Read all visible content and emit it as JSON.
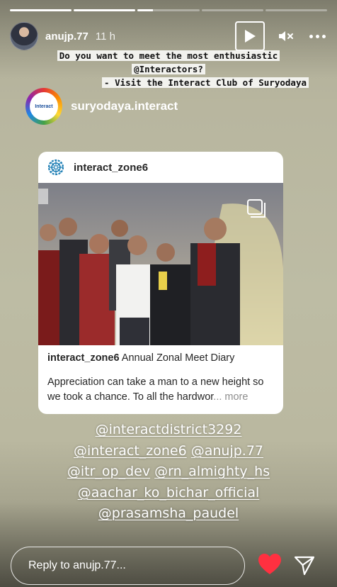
{
  "story": {
    "progress_segments": [
      1,
      1,
      0.25,
      0,
      0
    ],
    "user": {
      "username": "anujp.77",
      "time": "11 h"
    },
    "caption_lines": [
      "Do you want to meet the most enthusiastic",
      "@Interactors?",
      "- Visit the Interact Club of Suryodaya"
    ],
    "mention": {
      "name": "suryodaya.interact",
      "logo_text": "Interact"
    },
    "shared_post": {
      "account": "interact_zone6",
      "title_account": "interact_zone6",
      "title_text": "Annual Zonal Meet Diary",
      "body": "Appreciation can take a man to a new height so we took a chance. To all the hardwor",
      "more": "... more"
    },
    "tag_lines": [
      [
        "@interactdistrict3292"
      ],
      [
        "@interact_zone6",
        "@anujp.77"
      ],
      [
        "@itr_op_dev",
        "@rn_almighty_hs"
      ],
      [
        "@aachar_ko_bichar_official"
      ],
      [
        "@prasamsha_paudel"
      ]
    ],
    "reply_placeholder": "Reply to anujp.77...",
    "colors": {
      "heart": "#ff3040",
      "text": "#ffffff"
    },
    "icons": [
      "play-icon",
      "mute-icon",
      "more-icon",
      "rotary-wheel-icon",
      "carousel-icon",
      "heart-icon",
      "send-icon"
    ]
  }
}
